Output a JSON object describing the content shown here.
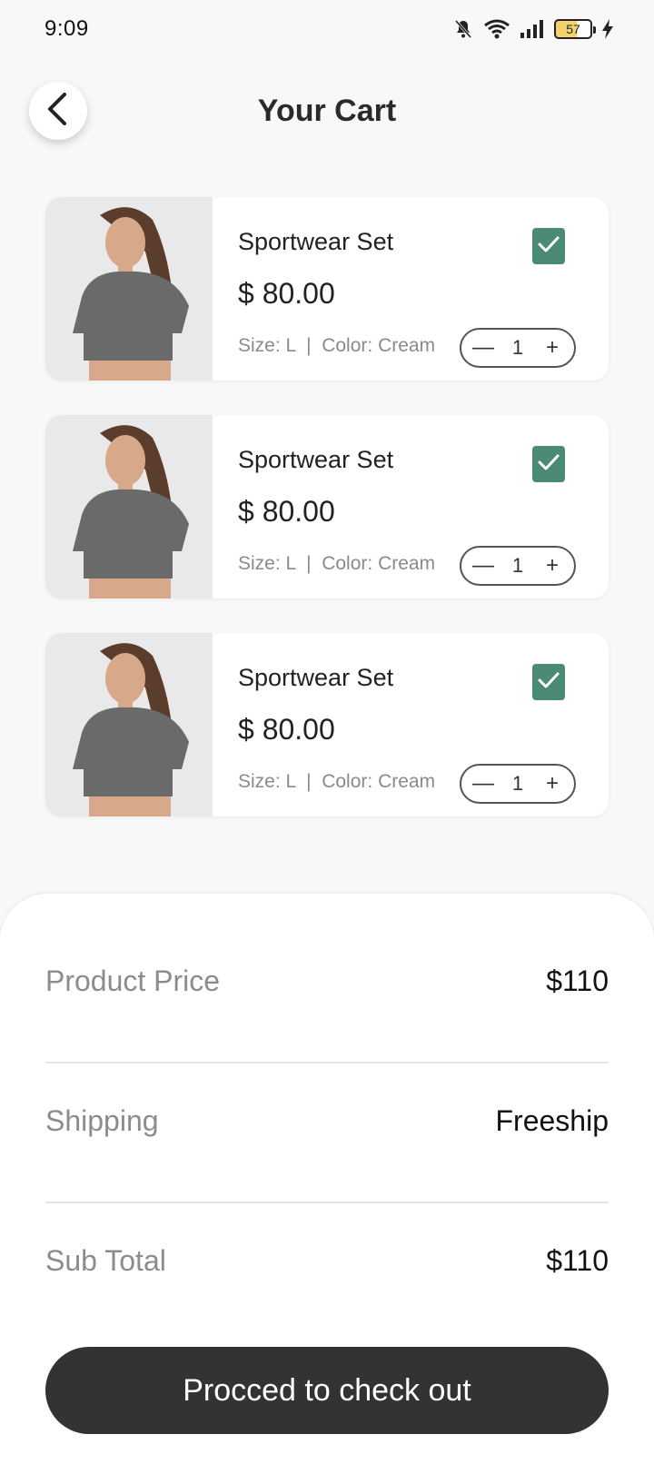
{
  "status_bar": {
    "time": "9:09",
    "battery": "57"
  },
  "header": {
    "title": "Your Cart"
  },
  "cart": {
    "items": [
      {
        "name": "Sportwear Set",
        "price": "$ 80.00",
        "meta": "Size: L  |  Color: Cream",
        "quantity": "1",
        "selected": true
      },
      {
        "name": "Sportwear Set",
        "price": "$ 80.00",
        "meta": "Size: L  |  Color: Cream",
        "quantity": "1",
        "selected": true
      },
      {
        "name": "Sportwear Set",
        "price": "$ 80.00",
        "meta": "Size: L  |  Color: Cream",
        "quantity": "1",
        "selected": true
      }
    ],
    "minus_symbol": "—",
    "plus_symbol": "+"
  },
  "summary": {
    "product_price_label": "Product Price",
    "product_price_value": "$110",
    "shipping_label": "Shipping",
    "shipping_value": "Freeship",
    "subtotal_label": "Sub Total",
    "subtotal_value": "$110"
  },
  "checkout": {
    "label": "Procced to check out"
  },
  "colors": {
    "accent_green": "#4b8a73",
    "button_dark": "#333333",
    "background": "#f8f8f8"
  }
}
